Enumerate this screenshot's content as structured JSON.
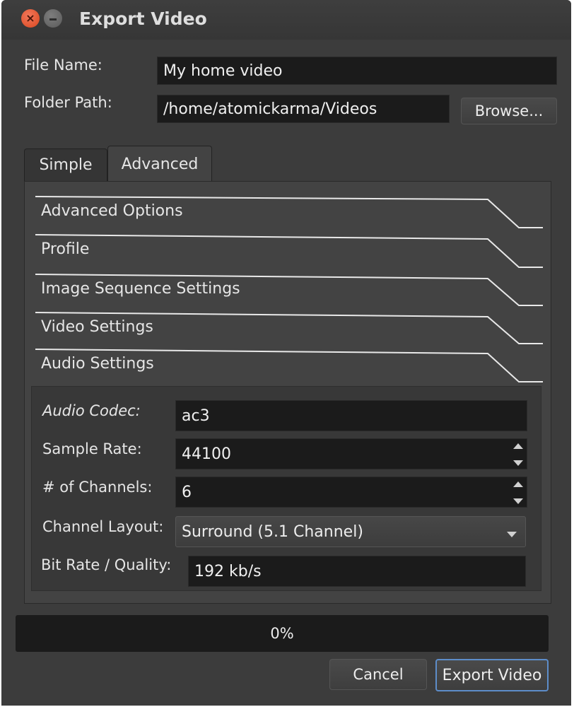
{
  "window": {
    "title": "Export Video"
  },
  "file": {
    "name_label": "File Name:",
    "name_value": "My home video",
    "folder_label": "Folder Path:",
    "folder_value": "/home/atomickarma/Videos",
    "browse_label": "Browse..."
  },
  "tabs": [
    {
      "label": "Simple",
      "active": false
    },
    {
      "label": "Advanced",
      "active": true
    }
  ],
  "sections": [
    {
      "label": "Advanced Options"
    },
    {
      "label": "Profile"
    },
    {
      "label": "Image Sequence Settings"
    },
    {
      "label": "Video Settings"
    },
    {
      "label": "Audio Settings"
    }
  ],
  "audio": {
    "codec_label": "Audio Codec:",
    "codec_value": "ac3",
    "sample_rate_label": "Sample Rate:",
    "sample_rate_value": "44100",
    "channels_label": "# of Channels:",
    "channels_value": "6",
    "layout_label": "Channel Layout:",
    "layout_value": "Surround (5.1 Channel)",
    "bitrate_label": "Bit Rate / Quality:",
    "bitrate_value": "192 kb/s"
  },
  "progress": {
    "percent": 0,
    "text": "0%"
  },
  "buttons": {
    "cancel": "Cancel",
    "export": "Export Video"
  },
  "colors": {
    "accent": "#5d8dc9",
    "close_button": "#e05a36"
  }
}
